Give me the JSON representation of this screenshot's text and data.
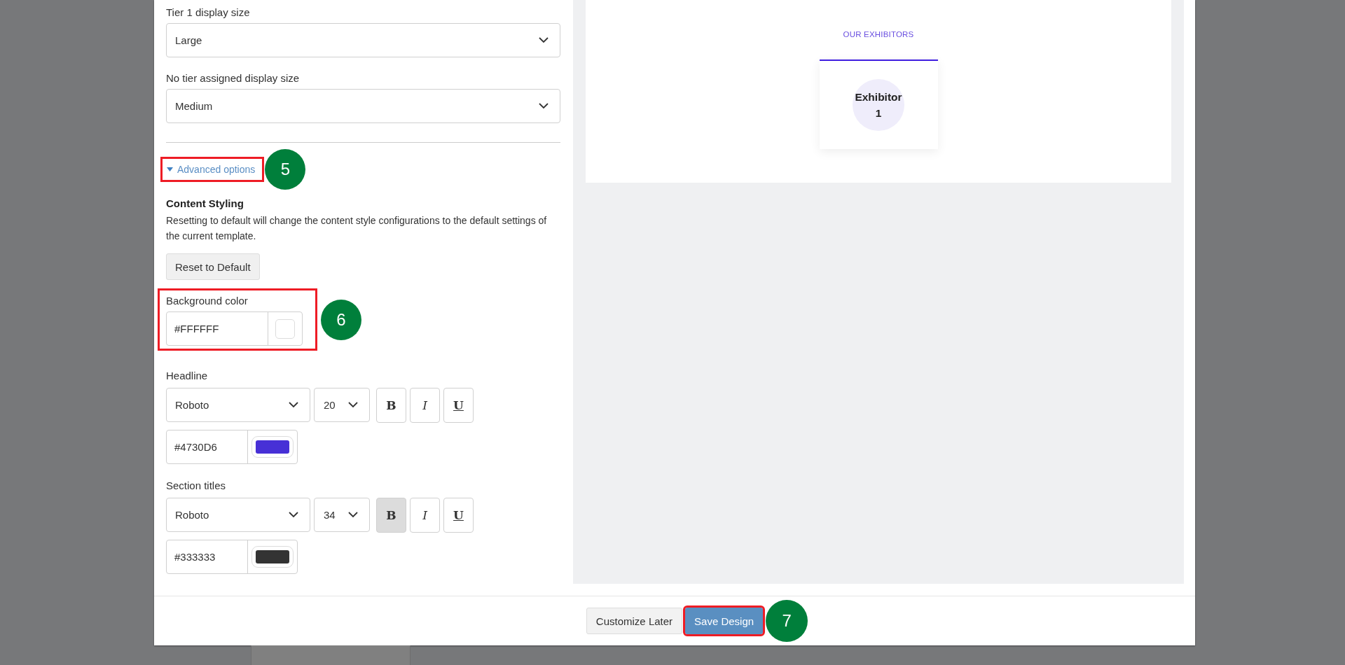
{
  "display_sizes": [
    {
      "label": "Tier 1 display size",
      "value": "Large"
    },
    {
      "label": "No tier assigned display size",
      "value": "Medium"
    }
  ],
  "advanced_options": {
    "label": "Advanced options",
    "expanded": true,
    "annotation": "5"
  },
  "content_styling": {
    "title": "Content Styling",
    "description": "Resetting to default will change the content style configurations to the default settings of the current template.",
    "reset_button": "Reset to Default",
    "background_color": {
      "label": "Background color",
      "value": "#FFFFFF",
      "color": "#ffffff",
      "annotation": "6"
    },
    "text_styles": [
      {
        "label": "Headline",
        "font": "Roboto",
        "size": "20",
        "color_value": "#4730D6",
        "color": "#4730d6",
        "format_buttons": [
          {
            "label": "B",
            "kind": "bold",
            "on": false
          },
          {
            "label": "I",
            "kind": "italic",
            "on": false
          },
          {
            "label": "U",
            "kind": "underline",
            "on": false
          }
        ]
      },
      {
        "label": "Section titles",
        "font": "Roboto",
        "size": "34",
        "color_value": "#333333",
        "color": "#333333",
        "format_buttons": [
          {
            "label": "B",
            "kind": "bold",
            "on": true
          },
          {
            "label": "I",
            "kind": "italic",
            "on": false
          },
          {
            "label": "U",
            "kind": "underline",
            "on": false
          }
        ]
      }
    ]
  },
  "preview": {
    "section_title": "OUR EXHIBITORS",
    "exhibitors": [
      {
        "name": "Exhibitor 1"
      }
    ]
  },
  "footer": {
    "buttons": [
      {
        "label": "Customize Later",
        "kind": "secondary"
      },
      {
        "label": "Save Design",
        "kind": "primary",
        "annotation": "7"
      }
    ]
  }
}
